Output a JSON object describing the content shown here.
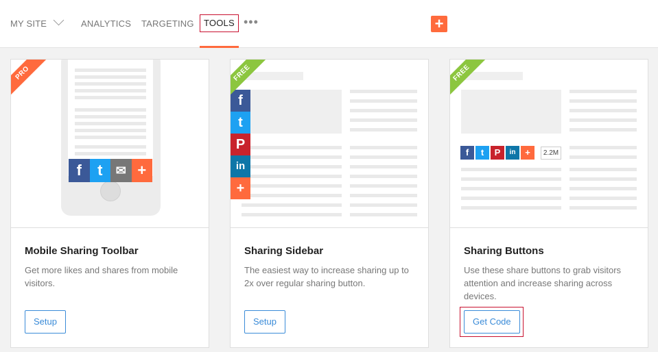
{
  "nav": {
    "site": "MY SITE",
    "items": [
      "ANALYTICS",
      "TARGETING",
      "TOOLS"
    ],
    "more": "•••",
    "add": "+"
  },
  "cards": [
    {
      "badge": "PRO",
      "title": "Mobile Sharing Toolbar",
      "description": "Get more likes and shares from mobile visitors.",
      "action": "Setup"
    },
    {
      "badge": "FREE",
      "title": "Sharing Sidebar",
      "description": "The easiest way to increase sharing up to 2x over regular sharing button.",
      "action": "Setup"
    },
    {
      "badge": "FREE",
      "title": "Sharing Buttons",
      "description": "Use these share buttons to grab visitors attention and increase sharing across devices.",
      "action": "Get Code",
      "share_count": "2.2M"
    }
  ],
  "icons": {
    "facebook": "f",
    "twitter": "t",
    "pinterest": "P",
    "linkedin": "in",
    "email": "✉",
    "plus": "+"
  },
  "colors": {
    "accent": "#ff6a3d",
    "link": "#3a8bd8",
    "free_ribbon": "#8cc63f",
    "facebook": "#3b5998",
    "twitter": "#1da1f2",
    "pinterest": "#c8232c",
    "linkedin": "#0e76a8"
  }
}
